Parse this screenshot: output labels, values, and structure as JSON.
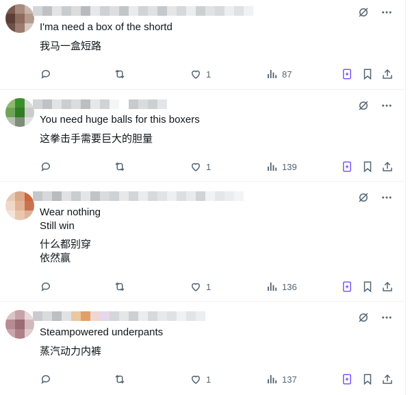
{
  "replies": [
    {
      "text_lines": [
        "I'ma need a box of the shortd"
      ],
      "translation_lines": [
        "我马一盒短路"
      ],
      "likes": "1",
      "views": "87"
    },
    {
      "text_lines": [
        "You need huge balls for this boxers"
      ],
      "translation_lines": [
        "这拳击手需要巨大的胆量"
      ],
      "likes": "1",
      "views": "139"
    },
    {
      "text_lines": [
        "Wear nothing",
        "Still win"
      ],
      "translation_lines": [
        "什么都别穿",
        "依然赢"
      ],
      "likes": "1",
      "views": "136"
    },
    {
      "text_lines": [
        "Steampowered underpants"
      ],
      "translation_lines": [
        "蒸汽动力内裤"
      ],
      "likes": "1",
      "views": "137"
    }
  ],
  "colors": {
    "text": "#0f1419",
    "muted": "#536471",
    "grok_accent": "#7856ff",
    "divider": "#eff3f4"
  },
  "icons": {
    "top": [
      "grok-slash-icon",
      "more-icon"
    ],
    "actions": [
      "reply-icon",
      "retweet-icon",
      "like-icon",
      "views-icon",
      "grok-icon",
      "bookmark-icon",
      "share-icon"
    ]
  }
}
